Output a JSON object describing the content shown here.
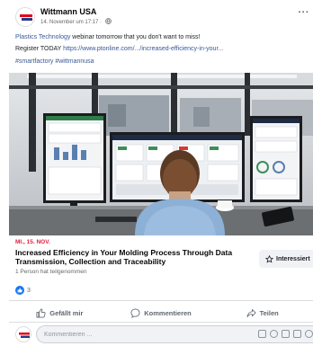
{
  "header": {
    "page_name": "Wittmann USA",
    "timestamp": "14. November um 17:17 ·",
    "more_label": "···"
  },
  "post": {
    "line1_link": "Plastics Technology",
    "line1_rest": " webinar tomorrow that you don't want to miss!",
    "line2_prefix": "Register TODAY ",
    "line2_link": "https://www.ptonline.com/.../increased-efficiency-in-your...",
    "hashtags": "#smartfactory #wittmannusa"
  },
  "event": {
    "date": "MI., 15. NOV.",
    "title": "Increased Efficiency in Your Molding Process Through Data Transmission, Collection and Traceability",
    "subtitle": "1 Person hat teilgenommen",
    "interest_label": "Interessiert"
  },
  "reactions": {
    "count": "3"
  },
  "actions": {
    "like": "Gefällt mir",
    "comment": "Kommentieren",
    "share": "Teilen"
  },
  "comment_box": {
    "placeholder": "Kommentieren ..."
  },
  "colors": {
    "link": "#385898",
    "date_red": "#e41e3f",
    "like_blue": "#1877f2",
    "logo_red": "#e30613",
    "logo_blue": "#233a87"
  },
  "icons": [
    "globe-icon",
    "more-icon",
    "star-icon",
    "like-reaction-icon",
    "thumbs-up-icon",
    "comment-bubble-icon",
    "share-arrow-icon",
    "sticker-icon",
    "emoji-icon",
    "camera-icon",
    "gif-icon",
    "sticker-alt-icon"
  ]
}
